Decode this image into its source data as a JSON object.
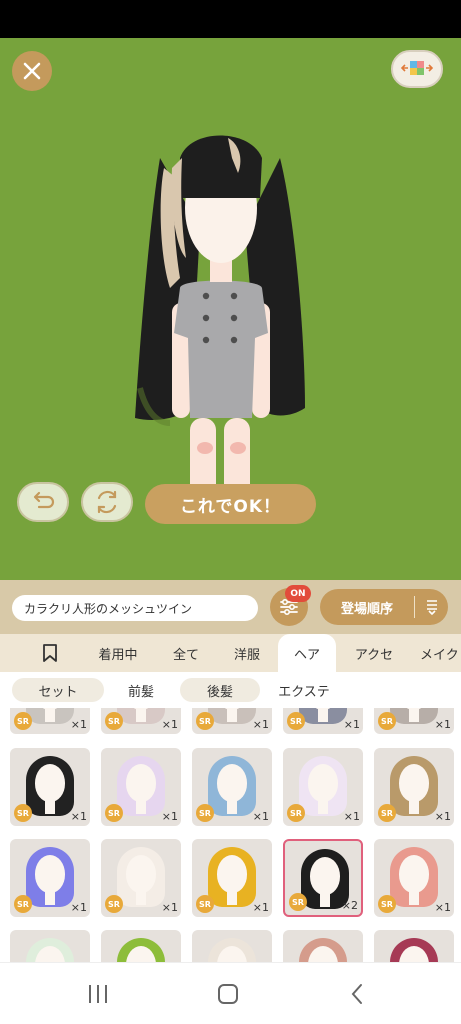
{
  "stage": {
    "close_icon": "close-icon",
    "palette_icon": "palette-icon"
  },
  "actions": {
    "undo_icon": "undo-icon",
    "shuffle_icon": "shuffle-icon",
    "ok_label": "これでOK！"
  },
  "toolbar": {
    "item_name": "カラクリ人形のメッシュツイン",
    "filter_badge": "ON",
    "sort_label": "登場順序"
  },
  "tabs": [
    {
      "label": "",
      "icon": "bookmark-icon"
    },
    {
      "label": "着用中"
    },
    {
      "label": "全て"
    },
    {
      "label": "洋服"
    },
    {
      "label": "ヘア",
      "active": true
    },
    {
      "label": "アクセ"
    },
    {
      "label": "メイク"
    }
  ],
  "subtabs": [
    {
      "label": "セット"
    },
    {
      "label": "前髪"
    },
    {
      "label": "後髪"
    },
    {
      "label": "エクステ"
    }
  ],
  "grid": {
    "rows": [
      [
        {
          "rarity": "SR",
          "count": "×1",
          "hair": "#c9c4bf"
        },
        {
          "rarity": "SR",
          "count": "×1",
          "hair": "#d8c9c6"
        },
        {
          "rarity": "SR",
          "count": "×1",
          "hair": "#c9c0ba"
        },
        {
          "rarity": "SR",
          "count": "×1",
          "hair": "#8a8ea0"
        },
        {
          "rarity": "SR",
          "count": "×1",
          "hair": "#b7aea8"
        }
      ],
      [
        {
          "rarity": "SR",
          "count": "×1",
          "hair": "#222222"
        },
        {
          "rarity": "SR",
          "count": "×1",
          "hair": "#e6d6ef"
        },
        {
          "rarity": "SR",
          "count": "×1",
          "hair": "#8fb6d8"
        },
        {
          "rarity": "SR",
          "count": "×1",
          "hair": "#efe4f3"
        },
        {
          "rarity": "SR",
          "count": "×1",
          "hair": "#b99a6a"
        }
      ],
      [
        {
          "rarity": "SR",
          "count": "×1",
          "hair": "#7e7ee8"
        },
        {
          "rarity": "SR",
          "count": "×1",
          "hair": "#f4ede6"
        },
        {
          "rarity": "SR",
          "count": "×1",
          "hair": "#e8b222"
        },
        {
          "rarity": "SR",
          "count": "×2",
          "hair": "#1e1e1e",
          "selected": true
        },
        {
          "rarity": "SR",
          "count": "×1",
          "hair": "#e99a8e"
        }
      ],
      [
        {
          "rarity": "",
          "count": "",
          "hair": "#dfeedc"
        },
        {
          "rarity": "",
          "count": "",
          "hair": "#8dbd3a"
        },
        {
          "rarity": "",
          "count": "",
          "hair": "#ece4da"
        },
        {
          "rarity": "",
          "count": "",
          "hair": "#d59c8c"
        },
        {
          "rarity": "",
          "count": "",
          "hair": "#a63a55"
        }
      ]
    ]
  },
  "nav": {
    "recents_icon": "recents-icon",
    "home_icon": "home-icon",
    "back_icon": "back-icon"
  },
  "colors": {
    "stage_bg": "#77a33c",
    "accent": "#c49a5c",
    "badge_red": "#e24b3b",
    "selected_border": "#e0607c"
  }
}
